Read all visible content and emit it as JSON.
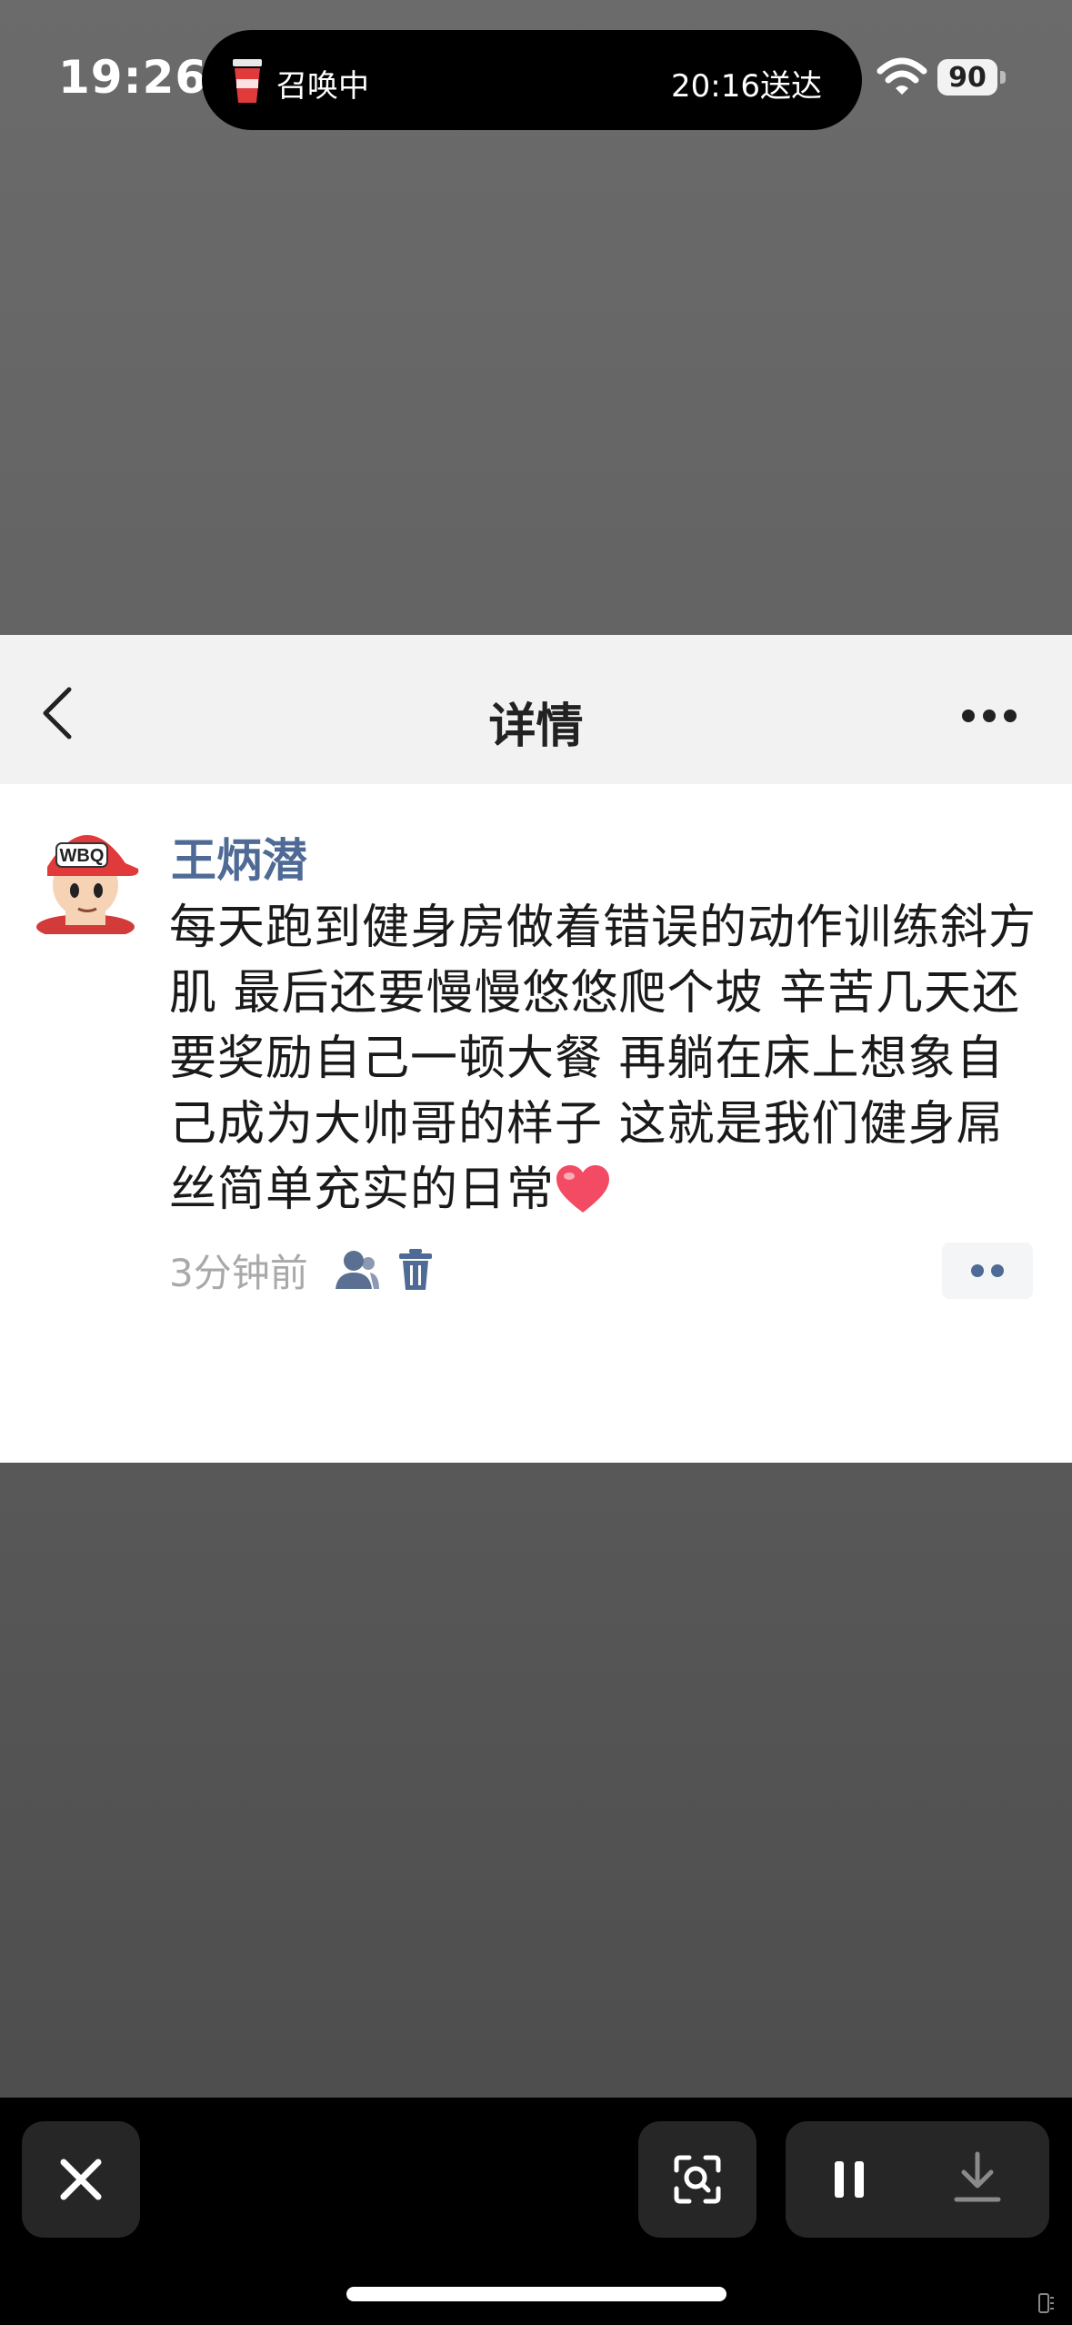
{
  "status_bar": {
    "time": "19:26",
    "island_left_text": "召唤中",
    "island_right_text": "20:16送达",
    "battery": "90"
  },
  "nav": {
    "title": "详情"
  },
  "post": {
    "username": "王炳潜",
    "avatar_cap_text": "WBQ",
    "content": "每天跑到健身房做着错误的动作训练斜方肌 最后还要慢慢悠悠爬个坡 辛苦几天还要奖励自己一顿大餐 再躺在床上想象自己成为大帅哥的样子 这就是我们健身屌丝简单充实的日常",
    "time_ago": "3分钟前"
  },
  "colors": {
    "username": "#4e6a95",
    "nav_background": "#f2f2f2",
    "heart": "#f24b63",
    "bottom_bar": "#000000"
  },
  "icons": [
    "cup-icon",
    "wifi-icon",
    "back-icon",
    "more-icon",
    "heart-emoji-icon",
    "person-icon",
    "trash-icon",
    "comment-dots-icon",
    "close-icon",
    "scan-icon",
    "pause-icon",
    "download-icon"
  ]
}
